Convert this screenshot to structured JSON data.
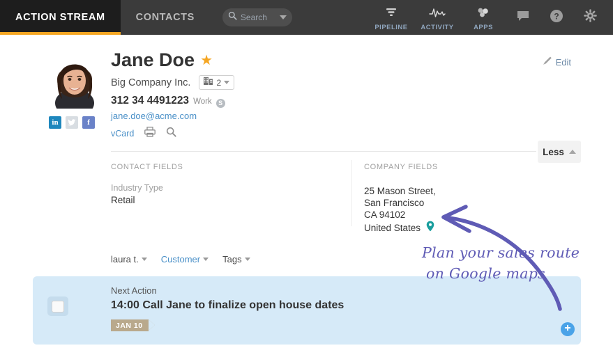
{
  "topnav": {
    "tabs": [
      {
        "label": "ACTION STREAM",
        "active": true
      },
      {
        "label": "CONTACTS",
        "active": false
      }
    ],
    "search": {
      "placeholder": "Search",
      "icon": "search-icon",
      "caret": "chevron-down-icon"
    },
    "items": [
      {
        "label": "PIPELINE",
        "icon": "funnel-icon"
      },
      {
        "label": "ACTIVITY",
        "icon": "pulse-icon"
      },
      {
        "label": "APPS",
        "icon": "apps-icon"
      }
    ],
    "icon_buttons": [
      {
        "icon": "chat-bubble-icon"
      },
      {
        "icon": "help-icon"
      },
      {
        "icon": "gear-icon"
      }
    ],
    "colors": {
      "bar": "#3b3b3b",
      "active_tab": "#1d1d1d",
      "accent": "#f5a623"
    }
  },
  "contact": {
    "name": "Jane Doe",
    "favorite_icon": "star-icon",
    "company": "Big Company Inc.",
    "company_count": "2",
    "company_icon": "building-icon",
    "phone": "312 34 4491223",
    "phone_label": "Work",
    "skype_icon": "skype-icon",
    "email": "jane.doe@acme.com",
    "vcard_label": "vCard",
    "print_icon": "printer-icon",
    "find_icon": "magnifier-icon",
    "avatar": "contact-photo",
    "social": [
      {
        "name": "linkedin",
        "glyph": "in",
        "color": "#1e87bd"
      },
      {
        "name": "twitter",
        "glyph": "t",
        "color": "#d8dde2"
      },
      {
        "name": "facebook",
        "glyph": "f",
        "color": "#6a82c8"
      }
    ],
    "edit_label": "Edit",
    "edit_icon": "pencil-icon"
  },
  "expand": {
    "label": "Less",
    "icon": "chevron-up-icon"
  },
  "contact_fields": {
    "header": "CONTACT FIELDS",
    "rows": [
      {
        "label": "Industry Type",
        "value": "Retail"
      }
    ]
  },
  "company_fields": {
    "header": "COMPANY FIELDS",
    "address": [
      "25 Mason Street,",
      "San Francisco",
      "CA 94102",
      "United States"
    ],
    "map_pin_icon": "map-pin-icon",
    "map_pin_color": "#1a9e9e"
  },
  "filters": [
    {
      "label": "laura t.",
      "style": "dark",
      "name": "owner-filter"
    },
    {
      "label": "Customer",
      "style": "blue",
      "name": "status-filter"
    },
    {
      "label": "Tags",
      "style": "dark",
      "name": "tags-filter"
    }
  ],
  "task": {
    "kicker": "Next Action",
    "title": "14:00 Call Jane to finalize open house dates",
    "date_badge": "JAN 10",
    "checkbox": "task-checkbox",
    "add_icon": "plus-icon",
    "panel_color": "#d6eaf8",
    "badge_color": "#b9a98c"
  },
  "annotation": {
    "line1": "Plan your sales route",
    "line2": "on Google maps",
    "color": "#5f5bb5",
    "arrow": "curved-arrow"
  }
}
